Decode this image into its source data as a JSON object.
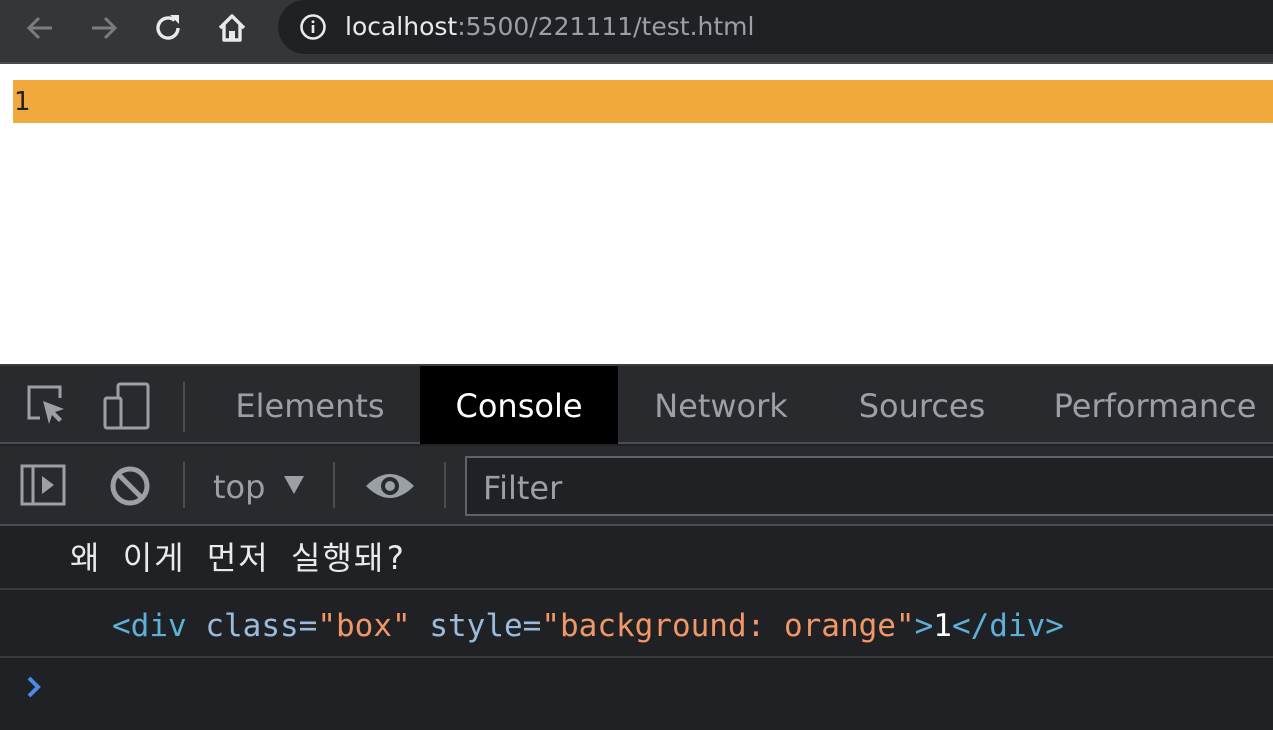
{
  "browser": {
    "url_host": "localhost",
    "url_path": ":5500/221111/test.html",
    "back_icon": "arrow-left-icon",
    "forward_icon": "arrow-right-icon",
    "reload_icon": "reload-icon",
    "home_icon": "home-icon",
    "site_info_icon": "info-icon"
  },
  "page": {
    "box_text": "1",
    "box_color": "#f2a93b"
  },
  "devtools": {
    "tabs": [
      "Elements",
      "Console",
      "Network",
      "Sources",
      "Performance"
    ],
    "active_tab": "Console",
    "context": "top",
    "filter_placeholder": "Filter"
  },
  "console": {
    "log_message": "왜 이게 먼저 실행돼?",
    "element_log": {
      "tag_open": "<div",
      "class_attr": "class",
      "class_value": "\"box\"",
      "style_attr": "style",
      "style_value": "\"background: orange\"",
      "gt": ">",
      "text": "1",
      "tag_close": "</div>"
    }
  }
}
